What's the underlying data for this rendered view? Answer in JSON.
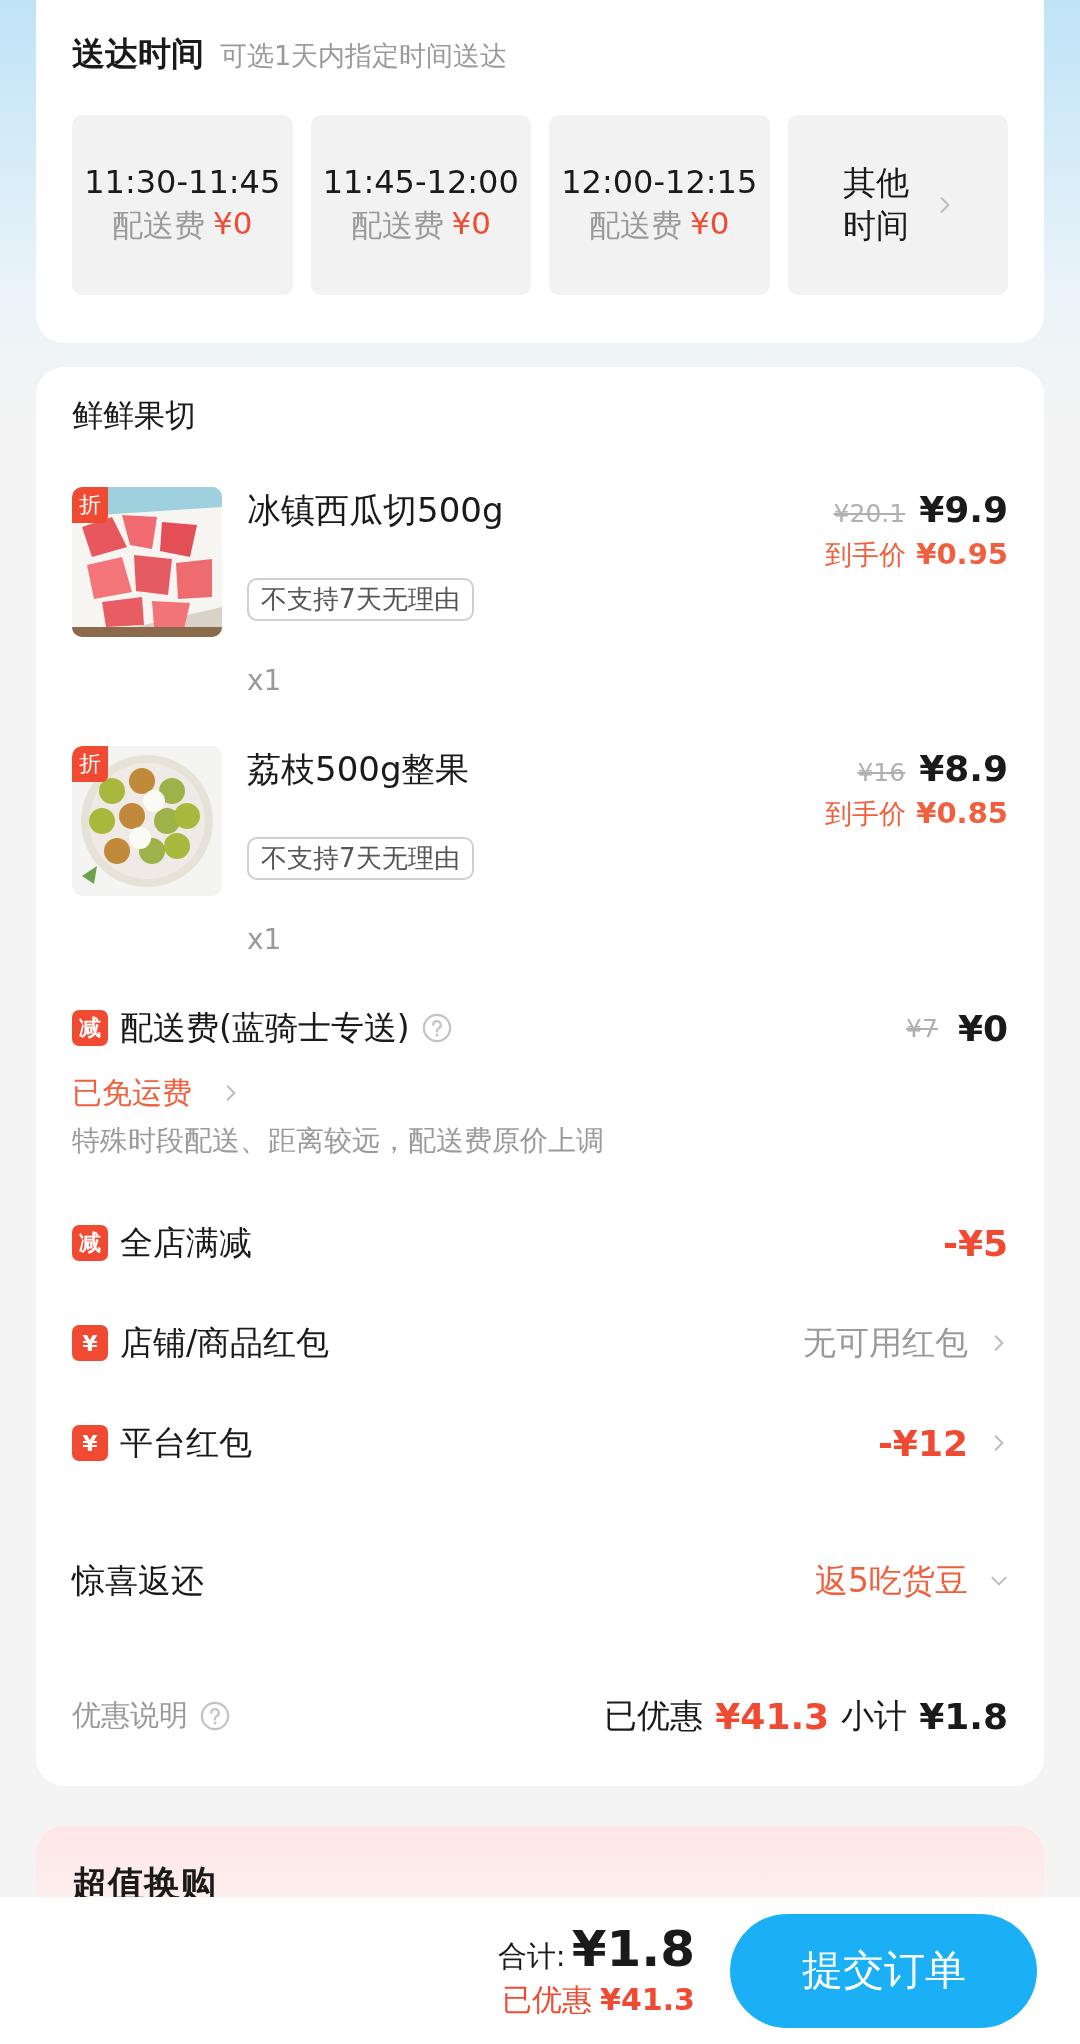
{
  "delivery": {
    "title": "送达时间",
    "subtitle": "可选1天内指定时间送达",
    "slots": [
      {
        "time": "11:30-11:45",
        "fee_label": "配送费",
        "fee": "¥0"
      },
      {
        "time": "11:45-12:00",
        "fee_label": "配送费",
        "fee": "¥0"
      },
      {
        "time": "12:00-12:15",
        "fee_label": "配送费",
        "fee": "¥0"
      }
    ],
    "other": "其他时间"
  },
  "store": {
    "name": "鲜鲜果切",
    "items": [
      {
        "badge": "折",
        "name": "冰镇西瓜切500g",
        "tag": "不支持7天无理由",
        "qty": "x1",
        "original_price": "¥20.1",
        "price": "¥9.9",
        "final_label": "到手价",
        "final_price": "¥0.95"
      },
      {
        "badge": "折",
        "name": "荔枝500g整果",
        "tag": "不支持7天无理由",
        "qty": "x1",
        "original_price": "¥16",
        "price": "¥8.9",
        "final_label": "到手价",
        "final_price": "¥0.85"
      }
    ],
    "delivery_fee": {
      "badge": "减",
      "label": "配送费(蓝骑士专送)",
      "original": "¥7",
      "value": "¥0",
      "link": "已免运费",
      "note": "特殊时段配送、距离较远，配送费原价上调"
    },
    "rows": [
      {
        "kind": "deduction",
        "badge": "减",
        "label": "全店满减",
        "value": "-¥5",
        "chevron": false
      },
      {
        "kind": "empty",
        "badge": "¥",
        "label": "店铺/商品红包",
        "value": "无可用红包",
        "chevron": true
      },
      {
        "kind": "deduction",
        "badge": "¥",
        "label": "平台红包",
        "value": "-¥12",
        "chevron": true
      }
    ],
    "surprise": {
      "label": "惊喜返还",
      "value": "返5吃货豆",
      "expanded": false
    },
    "summary": {
      "label": "优惠说明",
      "saved_label": "已优惠",
      "saved": "¥41.3",
      "subtotal_label": "小计",
      "subtotal": "¥1.8"
    }
  },
  "promo": {
    "title": "超值换购"
  },
  "bottom_bar": {
    "total_label": "合计:",
    "total": "¥1.8",
    "saved_label": "已优惠",
    "saved": "¥41.3",
    "submit": "提交订单"
  }
}
